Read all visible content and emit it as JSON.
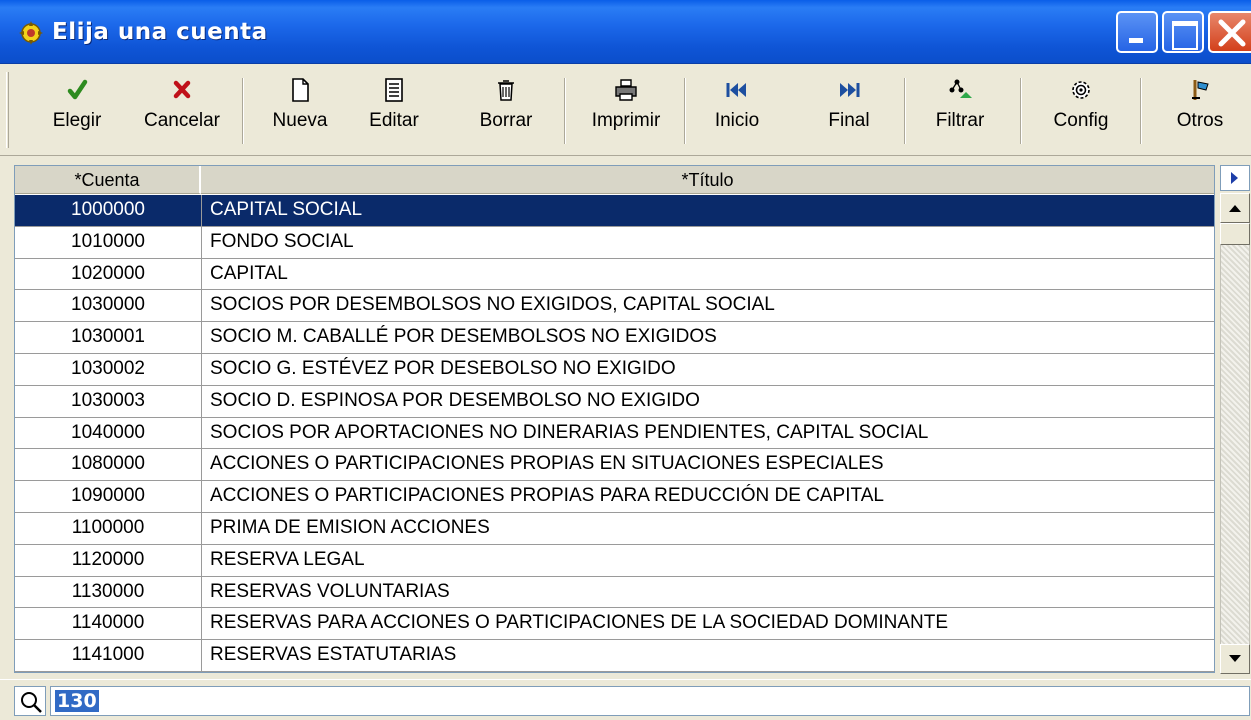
{
  "window": {
    "title": "Elija una cuenta"
  },
  "toolbar": {
    "buttons": [
      {
        "label": "Elegir",
        "icon": "check-icon"
      },
      {
        "label": "Cancelar",
        "icon": "cross-icon"
      },
      {
        "label": "Nueva",
        "icon": "new-document-icon"
      },
      {
        "label": "Editar",
        "icon": "edit-document-icon"
      },
      {
        "label": "Borrar",
        "icon": "trash-icon"
      },
      {
        "label": "Imprimir",
        "icon": "printer-icon"
      },
      {
        "label": "Inicio",
        "icon": "first-record-icon"
      },
      {
        "label": "Final",
        "icon": "last-record-icon"
      },
      {
        "label": "Filtrar",
        "icon": "filter-icon"
      },
      {
        "label": "Config",
        "icon": "gear-icon"
      },
      {
        "label": "Otros",
        "icon": "tools-icon"
      }
    ]
  },
  "grid": {
    "columns": [
      "*Cuenta",
      "*Título"
    ],
    "selected_index": 0,
    "rows": [
      {
        "cuenta": "1000000",
        "titulo": "CAPITAL SOCIAL"
      },
      {
        "cuenta": "1010000",
        "titulo": "FONDO SOCIAL"
      },
      {
        "cuenta": "1020000",
        "titulo": "CAPITAL"
      },
      {
        "cuenta": "1030000",
        "titulo": "SOCIOS POR DESEMBOLSOS NO EXIGIDOS, CAPITAL SOCIAL"
      },
      {
        "cuenta": "1030001",
        "titulo": "SOCIO M. CABALLÉ POR DESEMBOLSOS NO EXIGIDOS"
      },
      {
        "cuenta": "1030002",
        "titulo": "SOCIO G. ESTÉVEZ POR DESEBOLSO NO EXIGIDO"
      },
      {
        "cuenta": "1030003",
        "titulo": "SOCIO D. ESPINOSA POR DESEMBOLSO NO EXIGIDO"
      },
      {
        "cuenta": "1040000",
        "titulo": "SOCIOS POR APORTACIONES NO DINERARIAS PENDIENTES, CAPITAL SOCIAL"
      },
      {
        "cuenta": "1080000",
        "titulo": "ACCIONES O PARTICIPACIONES PROPIAS EN SITUACIONES ESPECIALES"
      },
      {
        "cuenta": "1090000",
        "titulo": "ACCIONES O PARTICIPACIONES PROPIAS PARA REDUCCIÓN DE CAPITAL"
      },
      {
        "cuenta": "1100000",
        "titulo": "PRIMA DE EMISION ACCIONES"
      },
      {
        "cuenta": "1120000",
        "titulo": "RESERVA LEGAL"
      },
      {
        "cuenta": "1130000",
        "titulo": "RESERVAS VOLUNTARIAS"
      },
      {
        "cuenta": "1140000",
        "titulo": "RESERVAS PARA ACCIONES O PARTICIPACIONES DE LA SOCIEDAD DOMINANTE"
      },
      {
        "cuenta": "1141000",
        "titulo": "RESERVAS ESTATUTARIAS"
      }
    ]
  },
  "search": {
    "value": "130"
  },
  "colors": {
    "titlebar": "#0f55d6",
    "selection": "#0a2a6a",
    "face": "#ece9d8"
  }
}
